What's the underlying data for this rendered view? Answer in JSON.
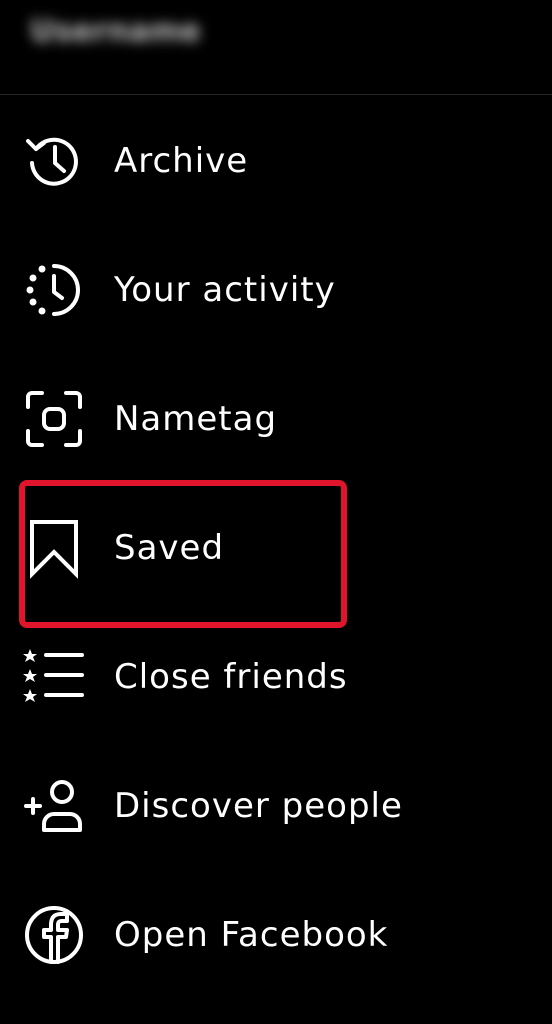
{
  "header": {
    "username": "Username"
  },
  "menu": {
    "items": [
      {
        "label": "Archive",
        "icon": "archive-icon"
      },
      {
        "label": "Your activity",
        "icon": "activity-icon"
      },
      {
        "label": "Nametag",
        "icon": "nametag-icon"
      },
      {
        "label": "Saved",
        "icon": "bookmark-icon"
      },
      {
        "label": "Close friends",
        "icon": "close-friends-icon"
      },
      {
        "label": "Discover people",
        "icon": "add-person-icon"
      },
      {
        "label": "Open Facebook",
        "icon": "facebook-icon"
      }
    ]
  },
  "colors": {
    "background": "#000000",
    "text": "#ffffff",
    "highlight": "#e0142b"
  }
}
